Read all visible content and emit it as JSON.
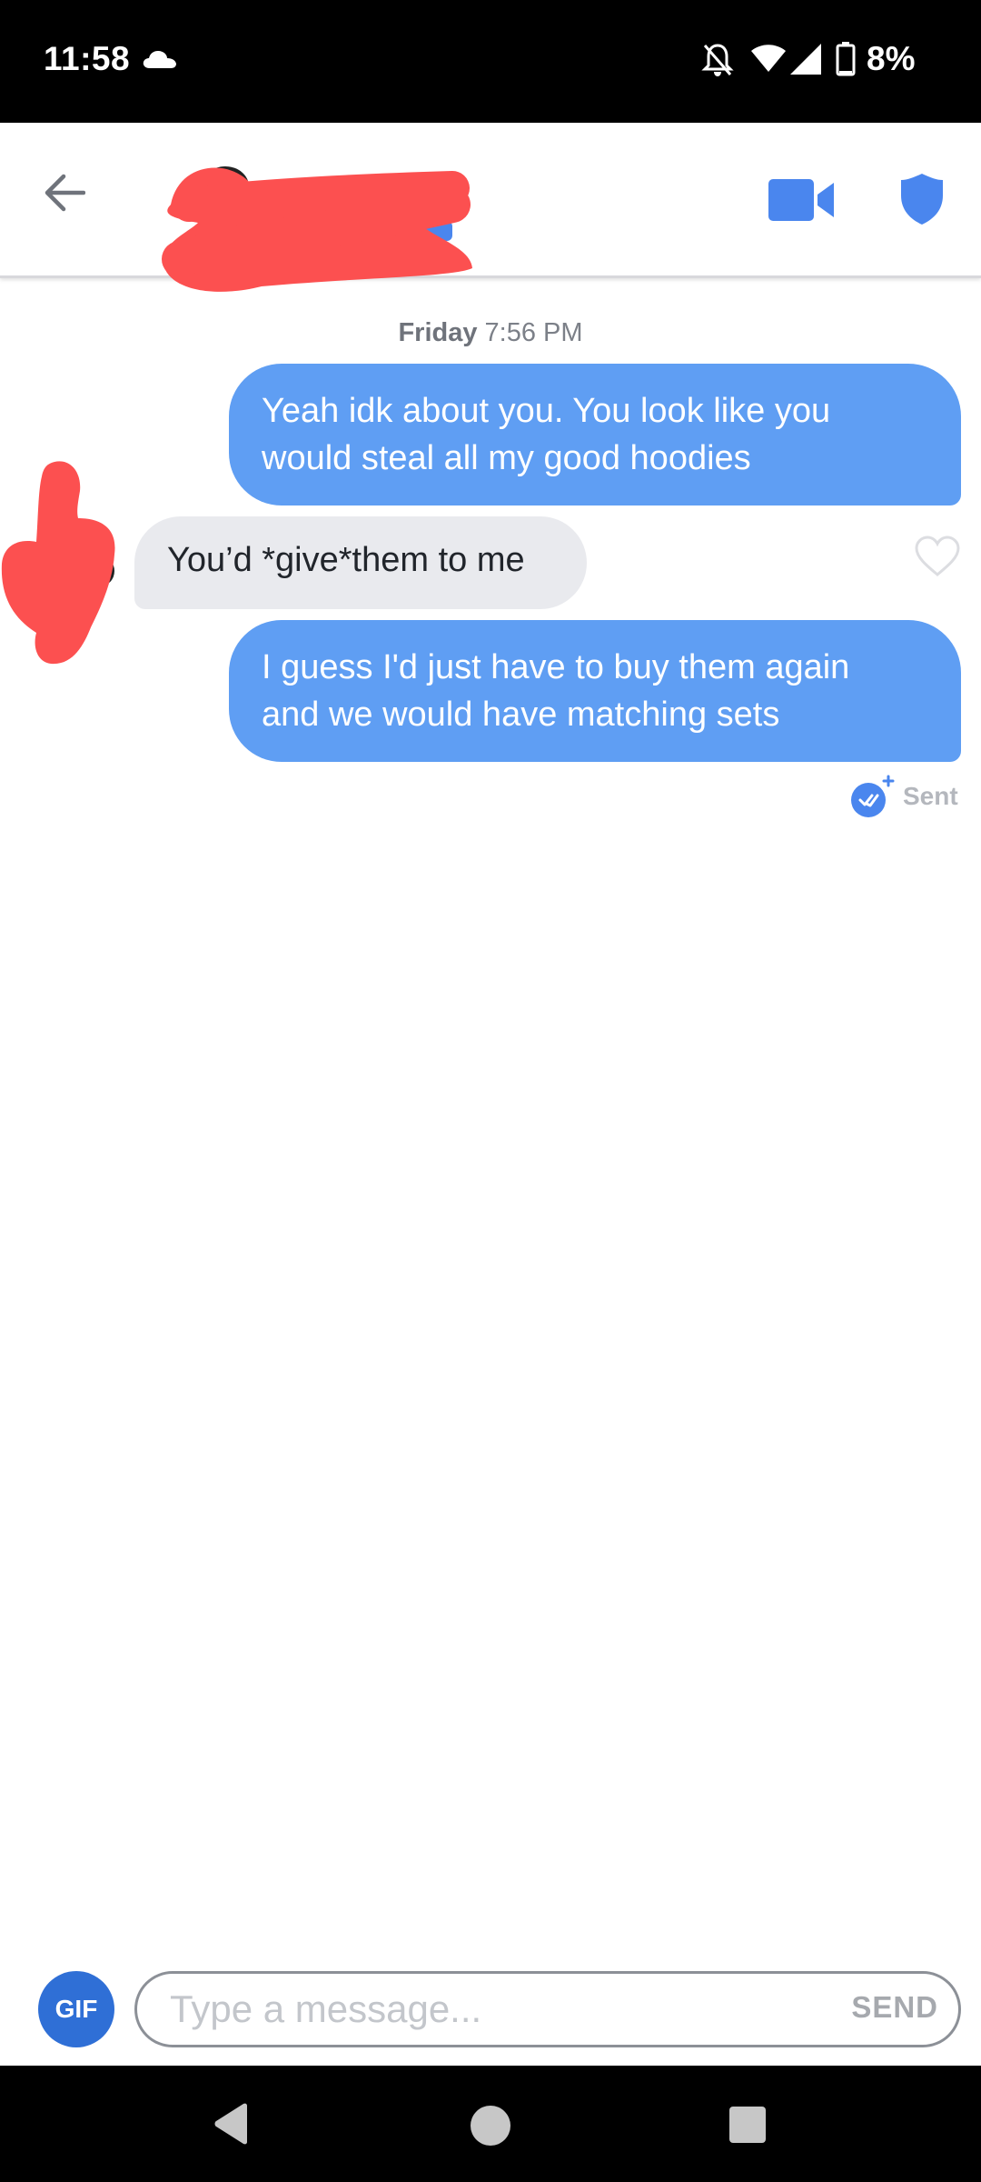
{
  "status_bar": {
    "time": "11:58",
    "battery": "8%",
    "icons": [
      "cloud-icon",
      "bell-off-icon",
      "wifi-icon",
      "signal-icon",
      "battery-icon"
    ]
  },
  "header": {
    "icons": [
      "back-arrow-icon",
      "video-call-icon",
      "shield-icon"
    ],
    "accent_color": "#4a86ee",
    "redaction_color": "#fc5050"
  },
  "conversation": {
    "timestamp_day": "Friday",
    "timestamp_time": "7:56 PM",
    "messages": [
      {
        "from": "me",
        "lines": [
          "Yeah idk about you. You look like you",
          "would steal all my good hoodies"
        ]
      },
      {
        "from": "them",
        "lines": [
          "You’d *give*them to me"
        ]
      },
      {
        "from": "me",
        "lines": [
          "I guess I'd just have to buy them again",
          "and we would have matching sets"
        ]
      }
    ],
    "delivery_status": "Sent",
    "sent_bubble_color": "#5f9ef3",
    "received_bubble_color": "#e9eaee"
  },
  "composer": {
    "gif_label": "GIF",
    "placeholder": "Type a message...",
    "value": "",
    "send_label": "SEND"
  },
  "nav_bar": {
    "icons": [
      "nav-back-icon",
      "nav-home-icon",
      "nav-recents-icon"
    ]
  }
}
